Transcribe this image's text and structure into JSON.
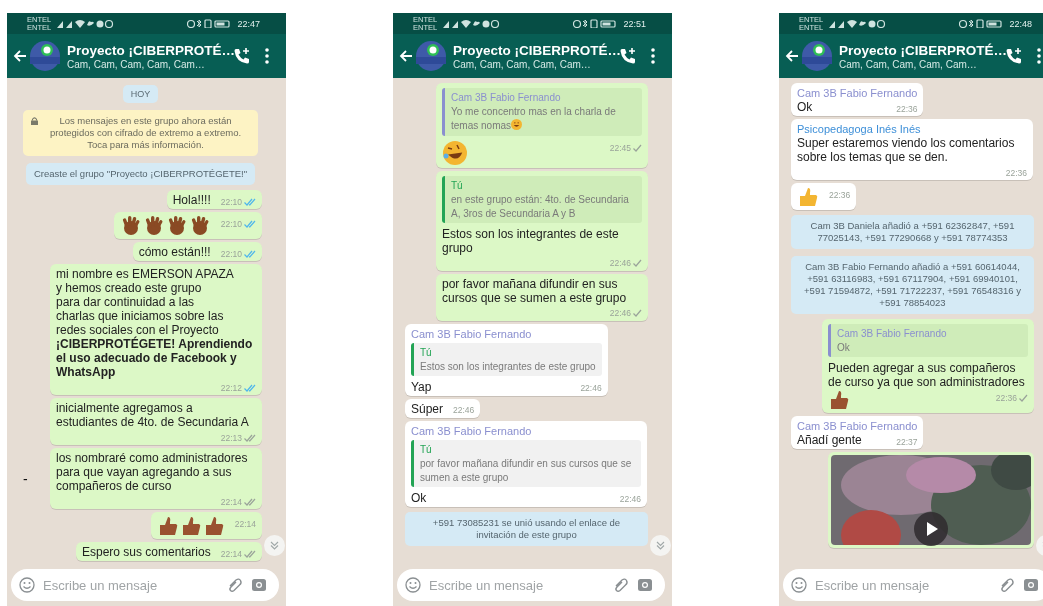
{
  "phones": [
    {
      "status": {
        "carriers": [
          "ENTEL",
          "ENTEL"
        ],
        "time": "22:47"
      },
      "header": {
        "title": "Proyecto ¡CIBERPROTÉ…",
        "subtitle": "Cam, Cam, Cam, Cam, Cam…"
      },
      "placeholder": "Escribe un mensaje",
      "messages": [
        {
          "kind": "date",
          "text": "HOY"
        },
        {
          "kind": "encryption",
          "text": "Los mensajes en este grupo ahora están protegidos con cifrado de extremo a extremo. Toca para más información."
        },
        {
          "kind": "system",
          "text": "Creaste el grupo \"Proyecto ¡CIBERPROTÉGETE!\""
        },
        {
          "kind": "out",
          "text": "Hola!!!!",
          "time": "22:10",
          "delivered": true,
          "read": true
        },
        {
          "kind": "out",
          "icons": [
            {
              "kind": "waving-hand",
              "color": "#8a4a24"
            },
            {
              "kind": "waving-hand",
              "color": "#8a4a24"
            },
            {
              "kind": "waving-hand",
              "color": "#8a4a24"
            },
            {
              "kind": "waving-hand",
              "color": "#8a4a24"
            }
          ],
          "time": "22:10",
          "delivered": true,
          "read": true
        },
        {
          "kind": "out",
          "text": "cómo están!!!",
          "time": "22:10",
          "delivered": true,
          "read": true
        },
        {
          "kind": "out",
          "text": "mi nombre es EMERSON APAZA\ny hemos creado este grupo\npara dar continuidad a las\ncharlas que iniciamos sobre las\nredes sociales con el Proyecto\n**¡CIBERPROTÉGETE! Aprendiendo el uso adecuado de Facebook y WhatsApp**",
          "time": "22:12",
          "delivered": true,
          "read": true
        },
        {
          "kind": "out",
          "text": "inicialmente agregamos a\nestudiantes de 4to. de Secundaria A",
          "time": "22:13",
          "delivered": true,
          "read": false
        },
        {
          "kind": "out",
          "text": "los nombraré como administradores para que vayan agregando a sus compañeros de curso",
          "time": "22:14",
          "delivered": true,
          "read": false,
          "margin_text": "-"
        },
        {
          "kind": "out",
          "icons": [
            {
              "kind": "thumbs-up",
              "color": "#9a5230"
            },
            {
              "kind": "thumbs-up",
              "color": "#9a5230"
            },
            {
              "kind": "thumbs-up",
              "color": "#9a5230"
            }
          ],
          "time": "22:14"
        },
        {
          "kind": "out",
          "text": "Espero sus comentarios",
          "time": "22:14",
          "delivered": true,
          "read": false
        }
      ]
    },
    {
      "status": {
        "carriers": [
          "ENTEL",
          "ENTEL"
        ],
        "time": "22:51"
      },
      "header": {
        "title": "Proyecto ¡CIBERPROTÉ…",
        "subtitle": "Cam, Cam, Cam, Cam, Cam…"
      },
      "placeholder": "Escribe un mensaje",
      "messages": [
        {
          "kind": "out",
          "quote": {
            "author": "Cam 3B Fabio Fernando",
            "color": "#8a8fcf",
            "text": "Yo me concentro mas en la charla de temas nomas",
            "icons": [
              {
                "kind": "grin-face",
                "color": "#f3b531"
              }
            ]
          },
          "icons": [
            {
              "kind": "laughing-face",
              "color": "#f3b531"
            }
          ],
          "time": "22:45",
          "delivered": false,
          "read": false
        },
        {
          "kind": "out",
          "quote": {
            "author": "Tú",
            "color": "#23a455",
            "text": "en este grupo están: 4to. de Secundaria A, 3ros de Secundaria A y B"
          },
          "text": "Estos son los integrantes de este grupo",
          "time": "22:46",
          "delivered": false,
          "read": false
        },
        {
          "kind": "out",
          "text": "por favor mañana difundir en sus cursos que se sumen a este grupo",
          "time": "22:46",
          "delivered": false,
          "read": false
        },
        {
          "kind": "in",
          "sender": "Cam 3B Fabio Fernando",
          "color": "#8a8fcf",
          "quote": {
            "author": "Tú",
            "color": "#23a455",
            "text": "Estos son los integrantes de este grupo"
          },
          "text": "Yap",
          "time": "22:46"
        },
        {
          "kind": "in",
          "text": "Súper",
          "time": "22:46"
        },
        {
          "kind": "in",
          "sender": "Cam 3B Fabio Fernando",
          "color": "#8a8fcf",
          "quote": {
            "author": "Tú",
            "color": "#23a455",
            "text": "por favor mañana difundir en sus cursos que se sumen a este grupo"
          },
          "text": "Ok",
          "time": "22:46"
        },
        {
          "kind": "system",
          "text": "+591 73085231 se unió usando el enlace de invitación de este grupo"
        }
      ]
    },
    {
      "status": {
        "carriers": [
          "ENTEL",
          "ENTEL"
        ],
        "time": "22:48"
      },
      "header": {
        "title": "Proyecto ¡CIBERPROTÉ…",
        "subtitle": "Cam, Cam, Cam, Cam, Cam…"
      },
      "placeholder": "Escribe un mensaje",
      "messages": [
        {
          "kind": "in",
          "sender": "Cam 3B Fabio Fernando",
          "color": "#8a8fcf",
          "text": "Ok",
          "time": "22:36"
        },
        {
          "kind": "in",
          "sender": "Psicopedagoga Inés Inés",
          "color": "#3d8fd8",
          "text": "Super estaremos viendo los comentarios sobre los temas  que se den.",
          "time": "22:36"
        },
        {
          "kind": "in",
          "icons": [
            {
              "kind": "thumbs-up",
              "color": "#f3b531"
            }
          ],
          "time": "22:36"
        },
        {
          "kind": "system",
          "text": "Cam 3B Daniela añadió a +591 62362847, +591 77025143, +591 77290668 y +591 78774353"
        },
        {
          "kind": "system",
          "text": "Cam 3B Fabio Fernando añadió a +591 60614044, +591 63116983, +591 67117904, +591 69940101, +591 71594872, +591 71722237, +591 76548316 y +591 78854023"
        },
        {
          "kind": "out",
          "quote": {
            "author": "Cam 3B Fabio Fernando",
            "color": "#8a8fcf",
            "text": "Ok"
          },
          "text": "Pueden agregar a sus compañeros de curso ya que son administradores",
          "icons": [
            {
              "kind": "thumbs-up",
              "color": "#9a5230"
            }
          ],
          "time": "22:36",
          "delivered": false,
          "read": false
        },
        {
          "kind": "in",
          "sender": "Cam 3B Fabio Fernando",
          "color": "#8a8fcf",
          "text": "Añadí gente",
          "time": "22:37"
        },
        {
          "kind": "video"
        }
      ]
    }
  ]
}
